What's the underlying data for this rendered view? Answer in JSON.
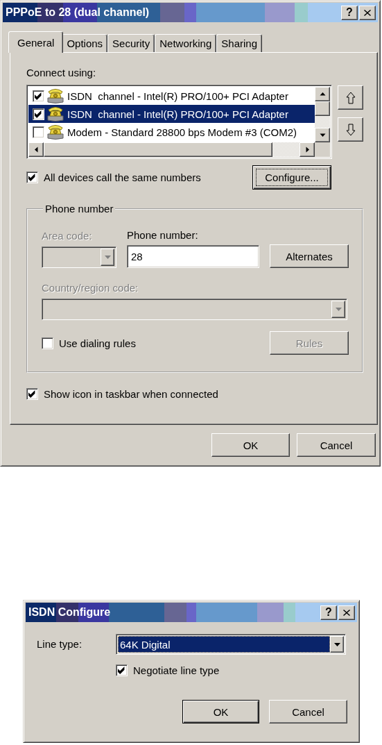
{
  "properties_dialog": {
    "title": "PPPoE to 28 (dual channel)",
    "help_button": "?",
    "tabs": [
      {
        "label": "General",
        "selected": true
      },
      {
        "label": "Options",
        "selected": false
      },
      {
        "label": "Security",
        "selected": false
      },
      {
        "label": "Networking",
        "selected": false
      },
      {
        "label": "Sharing",
        "selected": false
      }
    ],
    "connect_using": {
      "label": "Connect using:",
      "devices": [
        {
          "name": "ISDN  channel - Intel(R) PRO/100+ PCI Adapter",
          "checked": true,
          "selected": false
        },
        {
          "name": "ISDN  channel - Intel(R) PRO/100+ PCI Adapter",
          "checked": true,
          "selected": true
        },
        {
          "name": "Modem - Standard 28800 bps Modem #3 (COM2)",
          "checked": false,
          "selected": false
        }
      ]
    },
    "same_numbers": {
      "label": "All devices call the same numbers",
      "checked": true
    },
    "configure_button": {
      "label": "Configure...",
      "default": true,
      "focused": true
    },
    "phone_group": {
      "title": "Phone number",
      "area_code": {
        "label": "Area code:",
        "disabled": true
      },
      "phone_number": {
        "label": "Phone number:",
        "value": "28"
      },
      "alternates_button": {
        "label": "Alternates",
        "disabled": false
      },
      "country_code": {
        "label": "Country/region code:",
        "disabled": true
      },
      "dialing_rules": {
        "label": "Use dialing rules",
        "checked": false
      },
      "rules_button": {
        "label": "Rules",
        "disabled": true
      }
    },
    "show_icon": {
      "label": "Show icon in taskbar when connected",
      "checked": true
    },
    "buttons": [
      {
        "label": "OK",
        "default": false
      },
      {
        "label": "Cancel",
        "default": false
      }
    ]
  },
  "configure_dialog": {
    "title": "ISDN Configure",
    "help_button": "?",
    "line_type": {
      "label": "Line type:",
      "value": "64K Digital",
      "focused": true
    },
    "negotiate": {
      "label": "Negotiate line type",
      "checked": true
    },
    "buttons": [
      {
        "label": "OK",
        "default": true
      },
      {
        "label": "Cancel",
        "default": false
      }
    ]
  }
}
